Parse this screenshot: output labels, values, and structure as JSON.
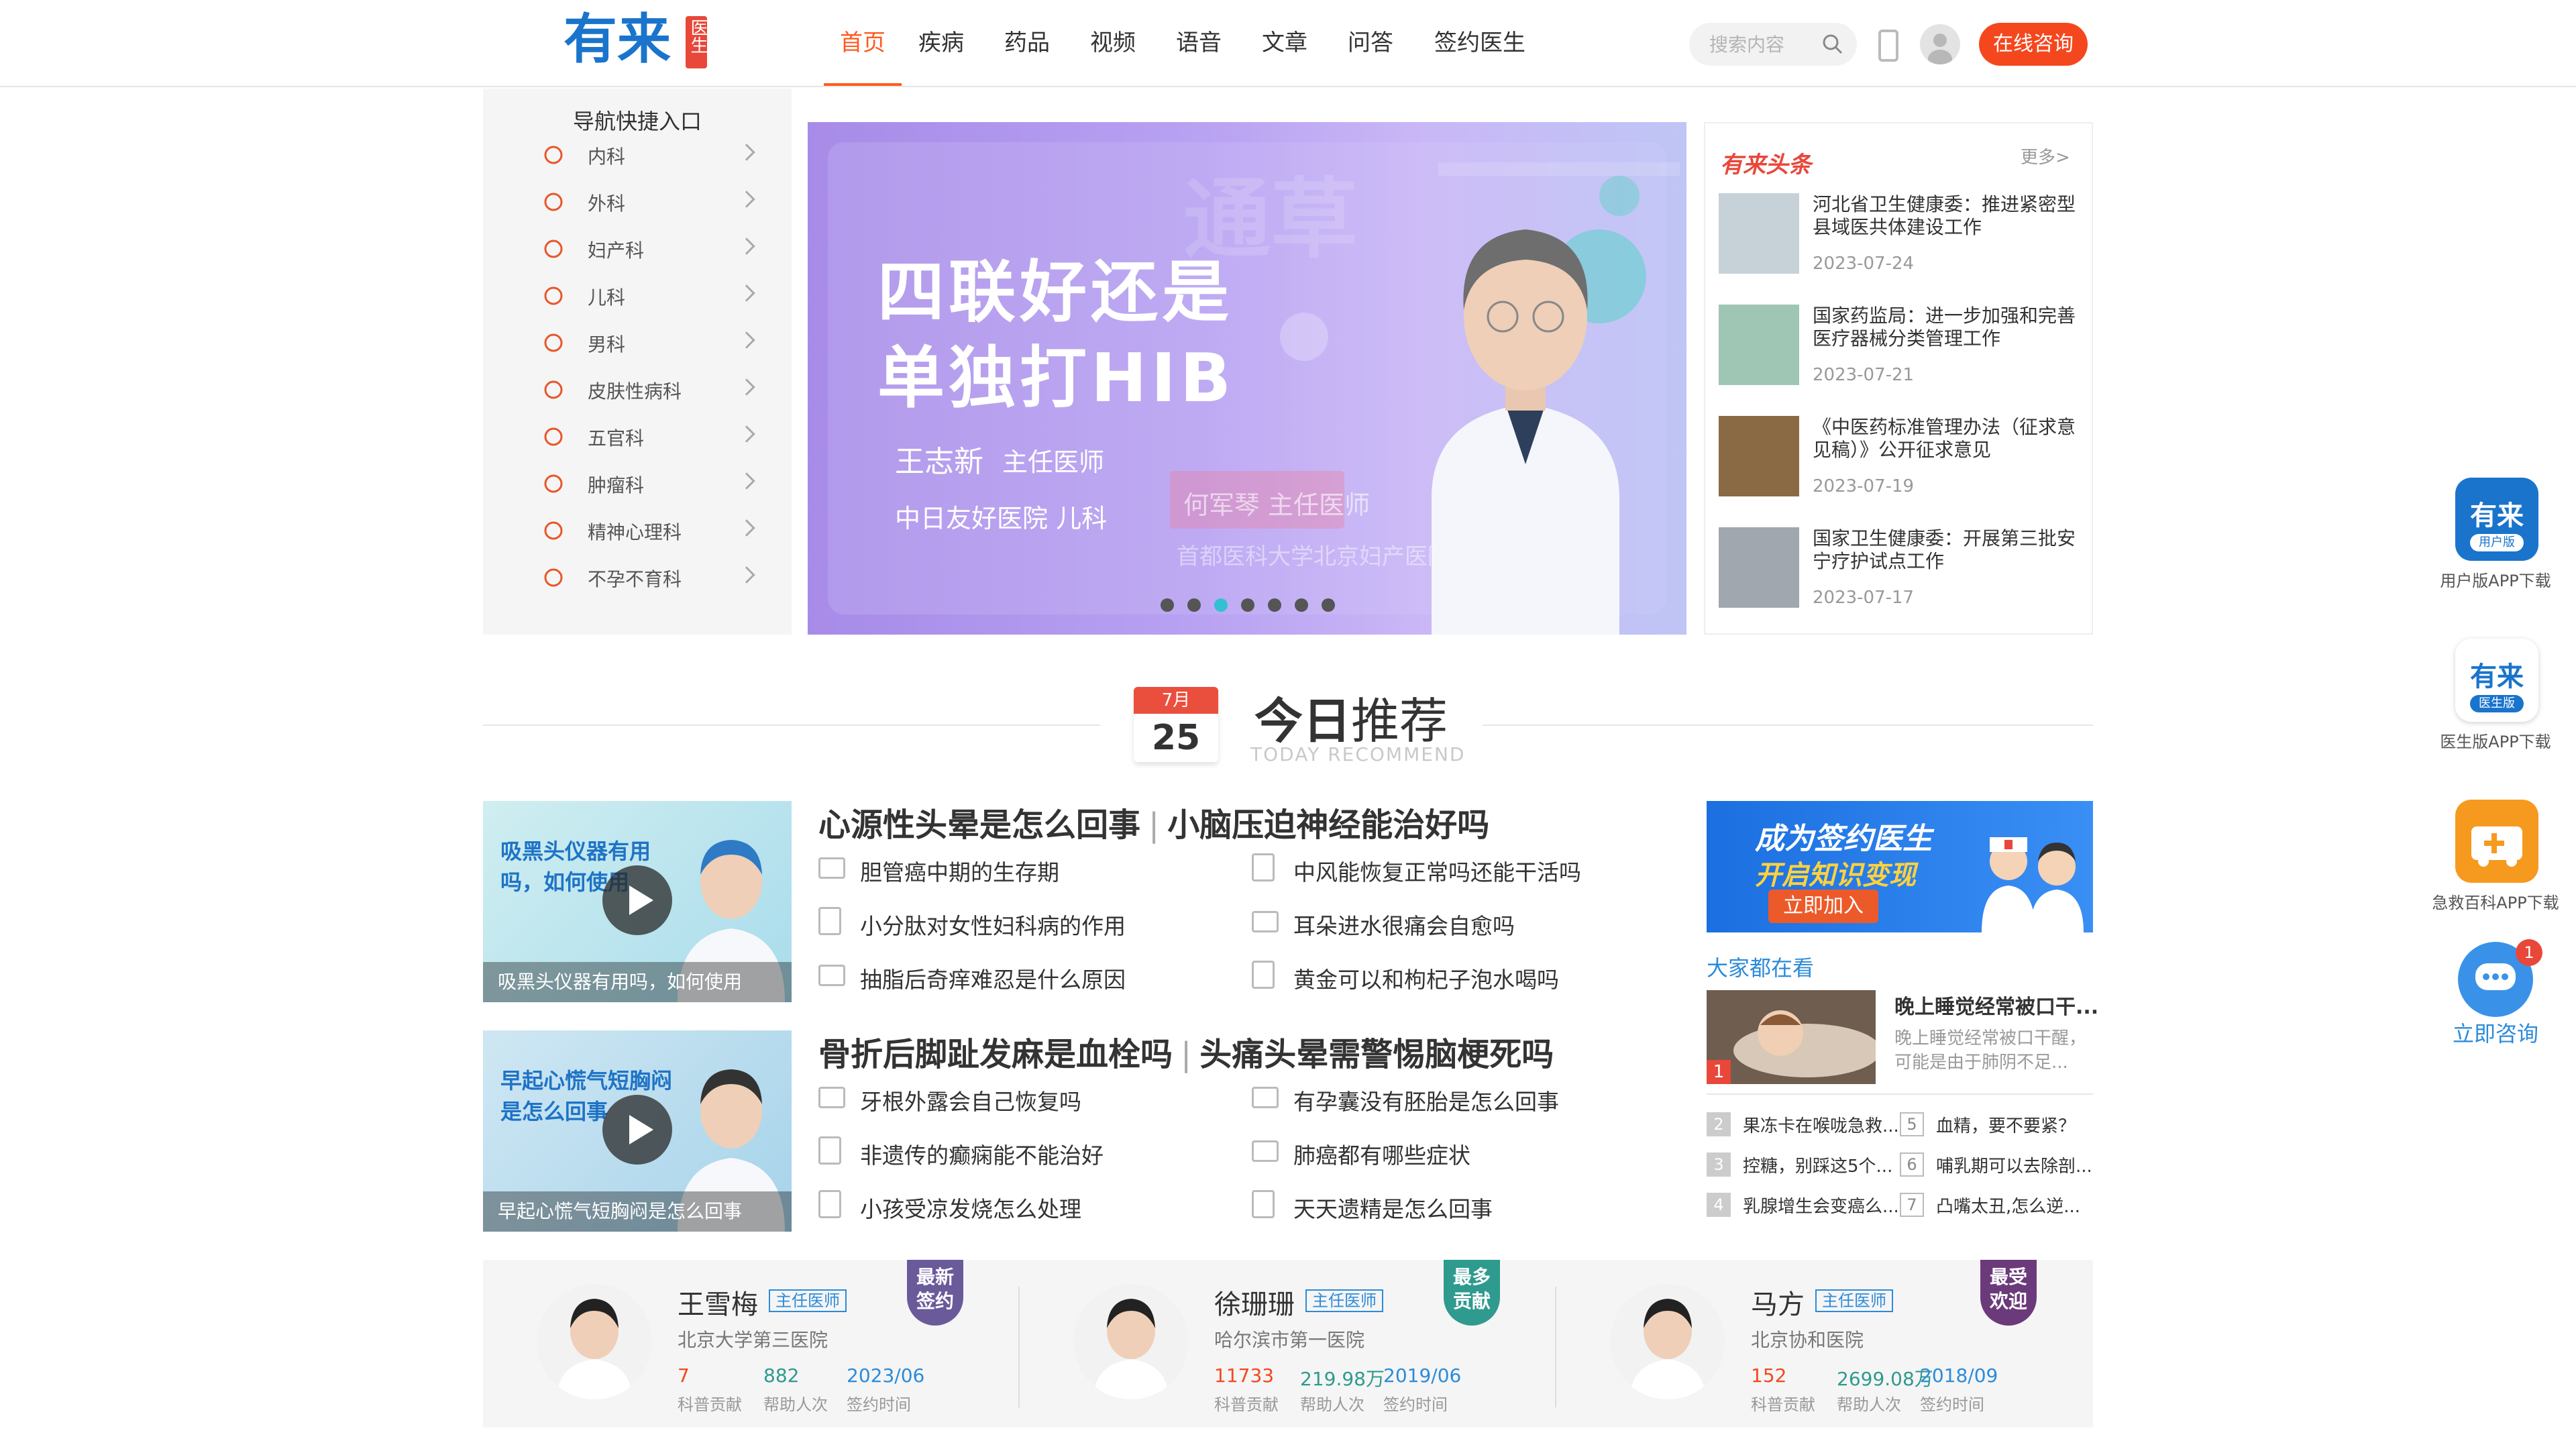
{
  "header": {
    "logo": {
      "main": "有来",
      "tag": "医生"
    },
    "nav": [
      "首页",
      "疾病",
      "药品",
      "视频",
      "语音",
      "文章",
      "问答",
      "签约医生"
    ],
    "active_index": 0,
    "search_placeholder": "搜索内容",
    "consult_button": "在线咨询"
  },
  "sidebar": {
    "title": "导航快捷入口",
    "items": [
      "内科",
      "外科",
      "妇产科",
      "儿科",
      "男科",
      "皮肤性病科",
      "五官科",
      "肿瘤科",
      "精神心理科",
      "不孕不育科"
    ]
  },
  "banner": {
    "title_line1": "四联好还是",
    "title_line2": "单独打HIB",
    "doctor_name": "王志新",
    "doctor_title": "主任医师",
    "hospital": "中日友好医院  儿科",
    "faded_name": "何军琴  主任医师",
    "faded_hospital": "首都医科大学北京妇产医院  中医科",
    "total_slides": 7,
    "active_slide": 3
  },
  "news": {
    "brand": "有来头条",
    "more": "更多>",
    "items": [
      {
        "title": "河北省卫生健康委：推进紧密型县域医共体建设工作",
        "date": "2023-07-24"
      },
      {
        "title": "国家药监局：进一步加强和完善医疗器械分类管理工作",
        "date": "2023-07-21"
      },
      {
        "title": "《中医药标准管理办法（征求意见稿）》公开征求意见",
        "date": "2023-07-19"
      },
      {
        "title": "国家卫生健康委：开展第三批安宁疗护试点工作",
        "date": "2023-07-17"
      }
    ]
  },
  "recommend": {
    "month": "7月",
    "day": "25",
    "title_bold": "今日",
    "title_rest": "推荐",
    "subtitle": "TODAY RECOMMEND",
    "groups": [
      {
        "video_caption": "吸黑头仪器有用吗，如何使用",
        "video_title": "吸黑头仪器有用吗，如何使用",
        "headline_a": "心源性头晕是怎么回事",
        "headline_b": "小脑压迫神经能治好吗",
        "links": [
          {
            "text": "胆管癌中期的生存期",
            "kind": "video"
          },
          {
            "text": "中风能恢复正常吗还能干活吗",
            "kind": "doc"
          },
          {
            "text": "小分肽对女性妇科病的作用",
            "kind": "doc"
          },
          {
            "text": "耳朵进水很痛会自愈吗",
            "kind": "video"
          },
          {
            "text": "抽脂后奇痒难忍是什么原因",
            "kind": "video"
          },
          {
            "text": "黄金可以和枸杞子泡水喝吗",
            "kind": "doc"
          }
        ]
      },
      {
        "video_caption": "早起心慌气短胸闷是怎么回事",
        "video_title": "早起心慌气短胸闷是怎么回事",
        "headline_a": "骨折后脚趾发麻是血栓吗",
        "headline_b": "头痛头晕需警惕脑梗死吗",
        "links": [
          {
            "text": "牙根外露会自己恢复吗",
            "kind": "video"
          },
          {
            "text": "有孕囊没有胚胎是怎么回事",
            "kind": "video"
          },
          {
            "text": "非遗传的癫痫能不能治好",
            "kind": "doc"
          },
          {
            "text": "肺癌都有哪些症状",
            "kind": "video"
          },
          {
            "text": "小孩受凉发烧怎么处理",
            "kind": "doc"
          },
          {
            "text": "天天遗精是怎么回事",
            "kind": "doc"
          }
        ]
      }
    ]
  },
  "sign_banner": {
    "line1": "成为签约医生",
    "line2": "开启知识变现",
    "button": "立即加入"
  },
  "popular": {
    "title": "大家都在看",
    "top": {
      "rank": "1",
      "headline": "晚上睡觉经常被口干...",
      "desc": "晚上睡觉经常被口干醒，可能是由于肺阴不足..."
    },
    "items": [
      {
        "rank": "2",
        "text": "果冻卡在喉咙急救..."
      },
      {
        "rank": "5",
        "text": "血精，要不要紧？"
      },
      {
        "rank": "3",
        "text": "控糖，别踩这5个..."
      },
      {
        "rank": "6",
        "text": "哺乳期可以去除剖..."
      },
      {
        "rank": "4",
        "text": "乳腺增生会变癌么..."
      },
      {
        "rank": "7",
        "text": "凸嘴太丑,怎么逆..."
      }
    ]
  },
  "doctors": [
    {
      "name": "王雪梅",
      "title": "主任医师",
      "hospital": "北京大学第三医院",
      "contrib": "7",
      "helped": "882",
      "signed": "2023/06",
      "badge": "最新签约",
      "badge_color": "#6a5a9a"
    },
    {
      "name": "徐珊珊",
      "title": "主任医师",
      "hospital": "哈尔滨市第一医院",
      "contrib": "11733",
      "helped": "219.98万",
      "signed": "2019/06",
      "badge": "最多贡献",
      "badge_color": "#2f9a8e"
    },
    {
      "name": "马方",
      "title": "主任医师",
      "hospital": "北京协和医院",
      "contrib": "152",
      "helped": "2699.08万",
      "signed": "2018/09",
      "badge": "最受欢迎",
      "badge_color": "#6b3a7a"
    }
  ],
  "doctor_labels": {
    "contrib": "科普贡献",
    "helped": "帮助人次",
    "signed": "签约时间"
  },
  "side_apps": [
    {
      "label": "用户版APP下载",
      "tag": "用户版"
    },
    {
      "label": "医生版APP下载",
      "tag": "医生版"
    },
    {
      "label": "急救百科APP下载"
    }
  ],
  "float_consult": {
    "label": "立即咨询",
    "badge": "1"
  },
  "colors": {
    "accent": "#f5471e",
    "brand_blue": "#1a74cc",
    "link_blue": "#2c8bd9"
  }
}
